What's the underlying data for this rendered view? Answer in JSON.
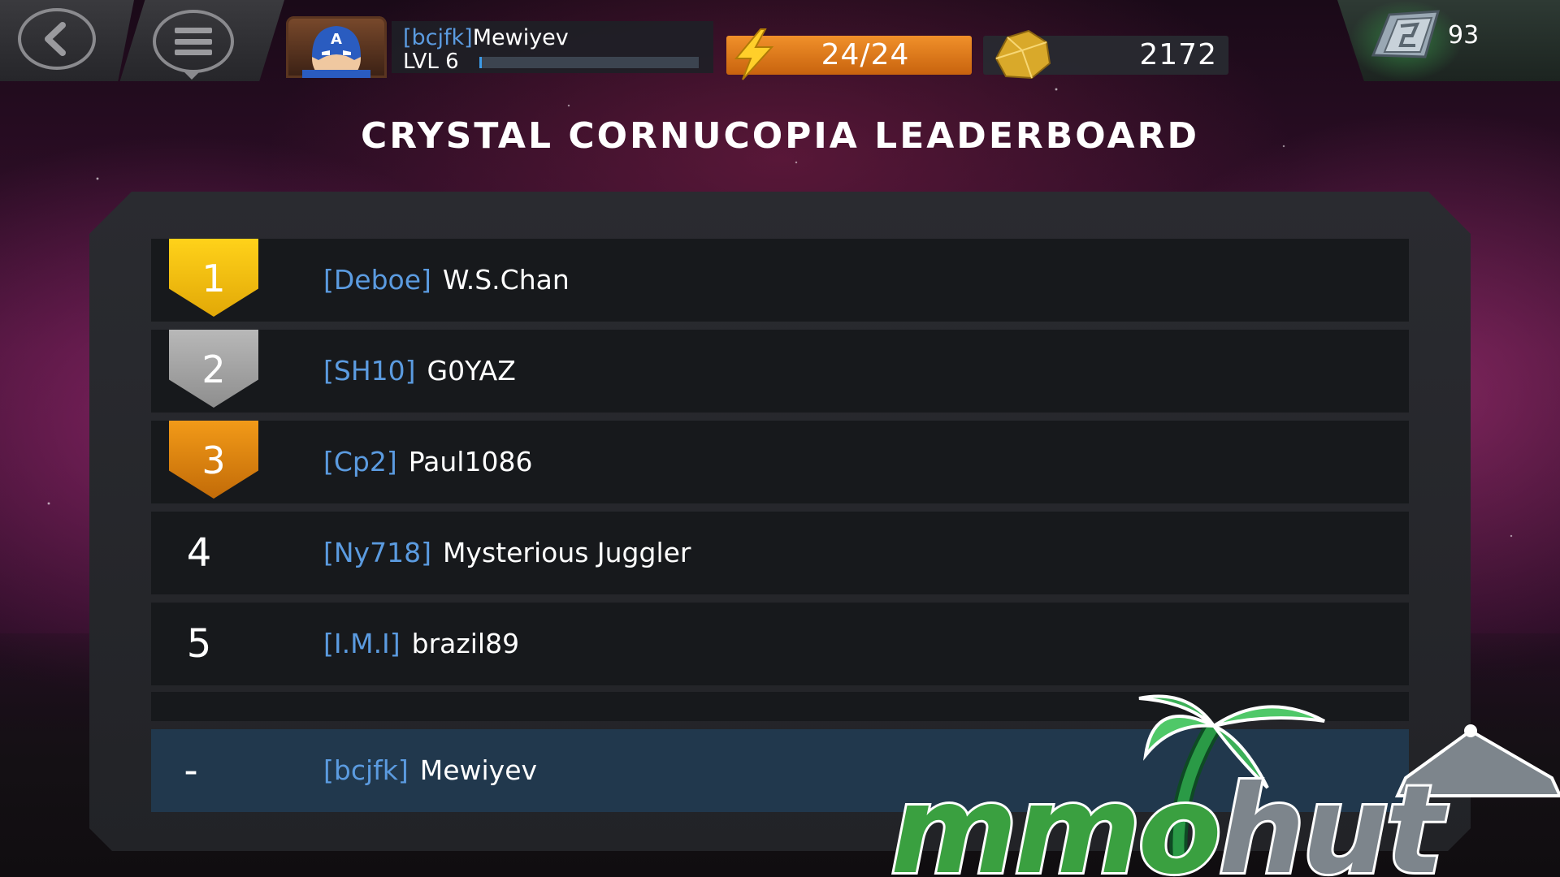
{
  "player": {
    "tag": "[bcjfk]",
    "name": "Mewiyev",
    "level_label": "LVL 6",
    "xp_fraction": 0.01
  },
  "energy": {
    "value": "24/24"
  },
  "gold": {
    "value": "2172"
  },
  "units": {
    "value": "93"
  },
  "title": "CRYSTAL CORNUCOPIA LEADERBOARD",
  "leaderboard": [
    {
      "rank": "1",
      "tag": "[Deboe]",
      "name": "W.S.Chan"
    },
    {
      "rank": "2",
      "tag": "[SH10]",
      "name": "G0YAZ"
    },
    {
      "rank": "3",
      "tag": "[Cp2]",
      "name": "Paul1086"
    },
    {
      "rank": "4",
      "tag": "[Ny718]",
      "name": "Mysterious Juggler"
    },
    {
      "rank": "5",
      "tag": "[I.M.I]",
      "name": "brazil89"
    }
  ],
  "current_user_row": {
    "rank": "-",
    "tag": "[bcjfk]",
    "name": "Mewiyev"
  },
  "colors": {
    "tag_blue": "#5b9be0",
    "gold_badge": "#ffd21a",
    "silver_badge": "#b8b8b8",
    "bronze_badge": "#f29a18",
    "energy_orange": "#e8801e",
    "user_row": "#21384d"
  },
  "icons": {
    "back": "back-arrow-icon",
    "menu": "menu-icon",
    "avatar": "captain-america-avatar",
    "energy": "lightning-icon",
    "gold": "gold-nugget-icon",
    "units": "units-icon"
  },
  "watermark": "mmohut"
}
